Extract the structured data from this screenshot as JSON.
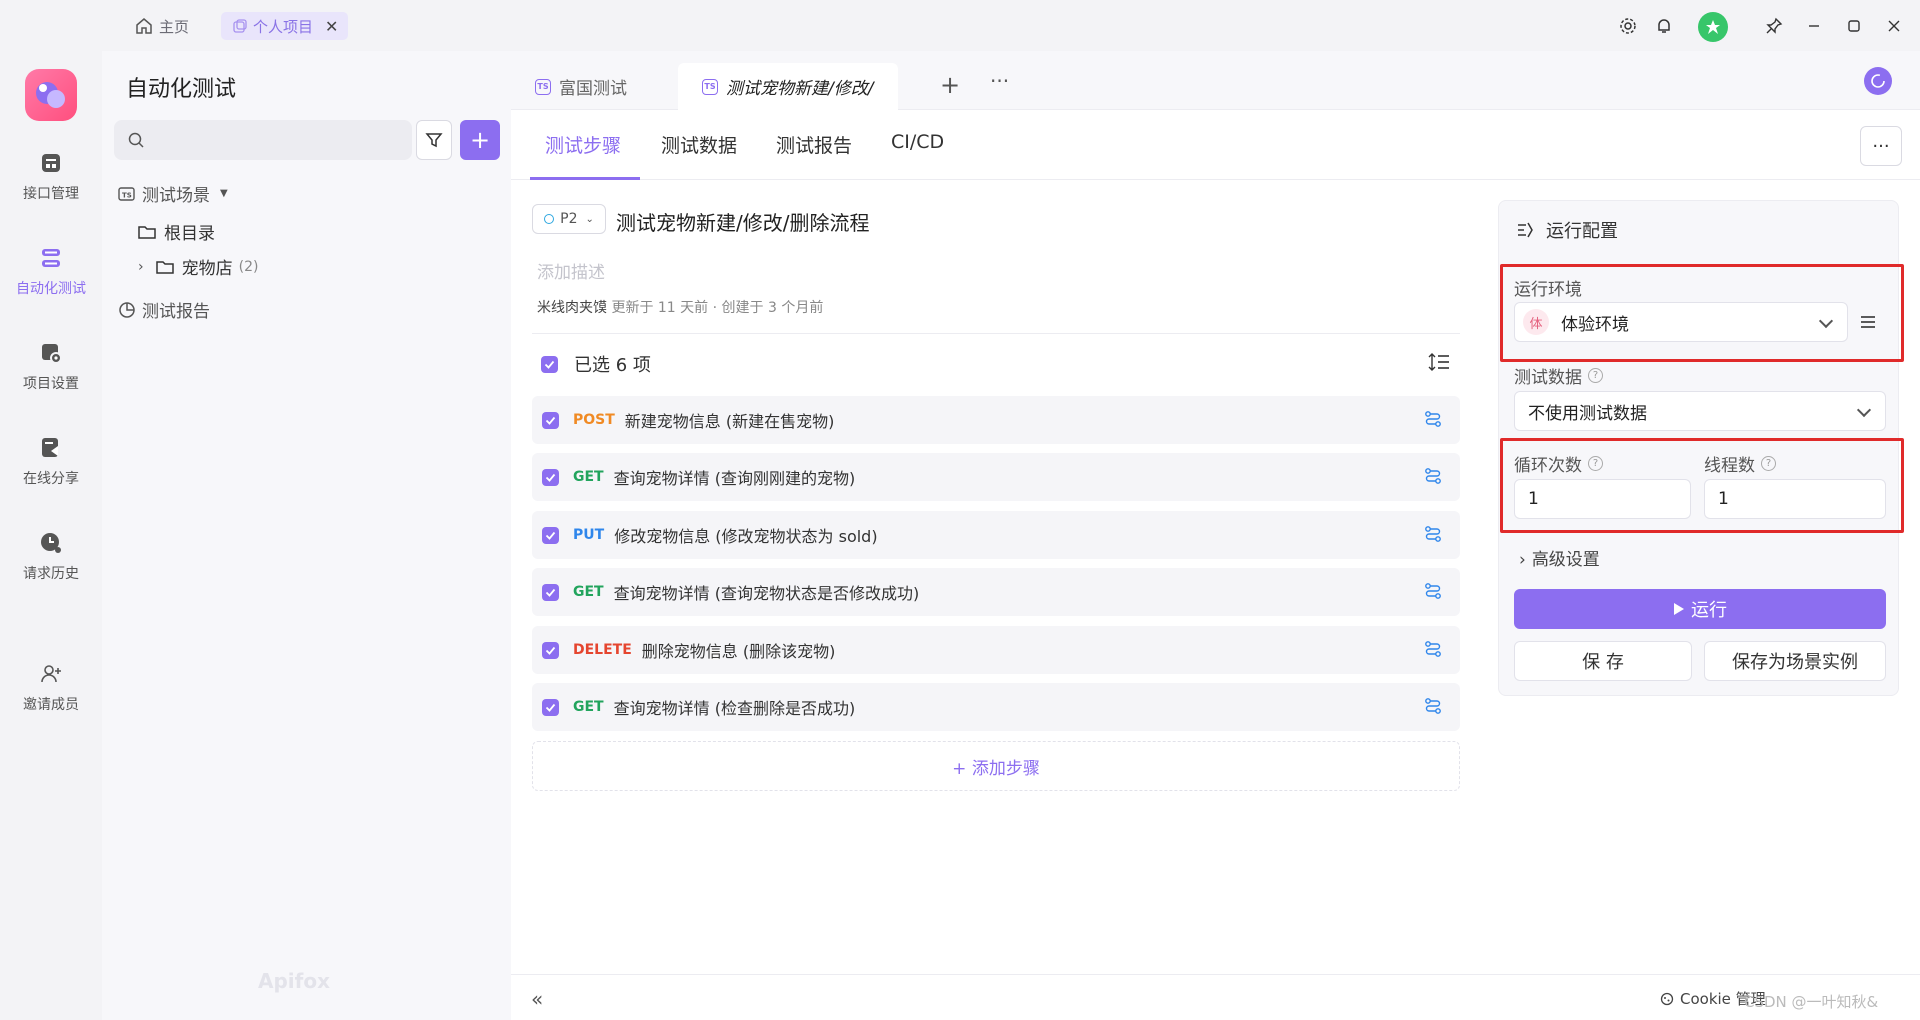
{
  "titlebar": {
    "home_tab": "主页",
    "project_tab": "个人项目",
    "close_symbol": "✕"
  },
  "leftnav": {
    "items": [
      {
        "label": "接口管理",
        "icon": "api-management-icon"
      },
      {
        "label": "自动化测试",
        "icon": "automation-test-icon",
        "active": true
      },
      {
        "label": "项目设置",
        "icon": "project-settings-icon"
      },
      {
        "label": "在线分享",
        "icon": "online-share-icon"
      },
      {
        "label": "请求历史",
        "icon": "request-history-icon"
      },
      {
        "label": "邀请成员",
        "icon": "invite-member-icon"
      }
    ]
  },
  "tree": {
    "title": "自动化测试",
    "scenes_label": "测试场景",
    "root_label": "根目录",
    "pet_store_label": "宠物店",
    "pet_store_count": "(2)",
    "reports_label": "测试报告",
    "watermark": "Apifox"
  },
  "doc_tabs": [
    {
      "label": "富国测试"
    },
    {
      "label": "测试宠物新建/修改/"
    }
  ],
  "sub_tabs": [
    "测试步骤",
    "测试数据",
    "测试报告",
    "CI/CD"
  ],
  "case": {
    "priority": "P2",
    "title": "测试宠物新建/修改/删除流程",
    "description_placeholder": "添加描述",
    "author": "米线肉夹馍",
    "updated": "更新于 11 天前",
    "created": "· 创建于 3 个月前",
    "selected_text": "已选 6 项",
    "add_step": "+ 添加步骤"
  },
  "steps": [
    {
      "method": "POST",
      "color": "#f08a24",
      "name": "新建宠物信息 (新建在售宠物)"
    },
    {
      "method": "GET",
      "color": "#22a45d",
      "name": "查询宠物详情 (查询刚刚建的宠物)"
    },
    {
      "method": "PUT",
      "color": "#2f86eb",
      "name": "修改宠物信息 (修改宠物状态为 sold)"
    },
    {
      "method": "GET",
      "color": "#22a45d",
      "name": "查询宠物详情 (查询宠物状态是否修改成功)"
    },
    {
      "method": "DELETE",
      "color": "#e5452f",
      "name": "删除宠物信息 (删除该宠物)"
    },
    {
      "method": "GET",
      "color": "#22a45d",
      "name": "查询宠物详情 (检查删除是否成功)"
    }
  ],
  "run_config": {
    "title": "运行配置",
    "env_label": "运行环境",
    "env_badge": "体",
    "env_value": "体验环境",
    "data_label": "测试数据",
    "data_value": "不使用测试数据",
    "loop_label": "循环次数",
    "loop_value": "1",
    "thread_label": "线程数",
    "thread_value": "1",
    "advanced": "高级设置",
    "run_button": "运行",
    "save_button": "保 存",
    "save_as_button": "保存为场景实例",
    "help_symbol": "?"
  },
  "footer": {
    "cookie_label": "Cookie 管理",
    "watermark": "CSDN @一叶知秋&"
  },
  "colors": {
    "accent": "#8c6ef0",
    "highlight_box": "#e02a2a"
  }
}
